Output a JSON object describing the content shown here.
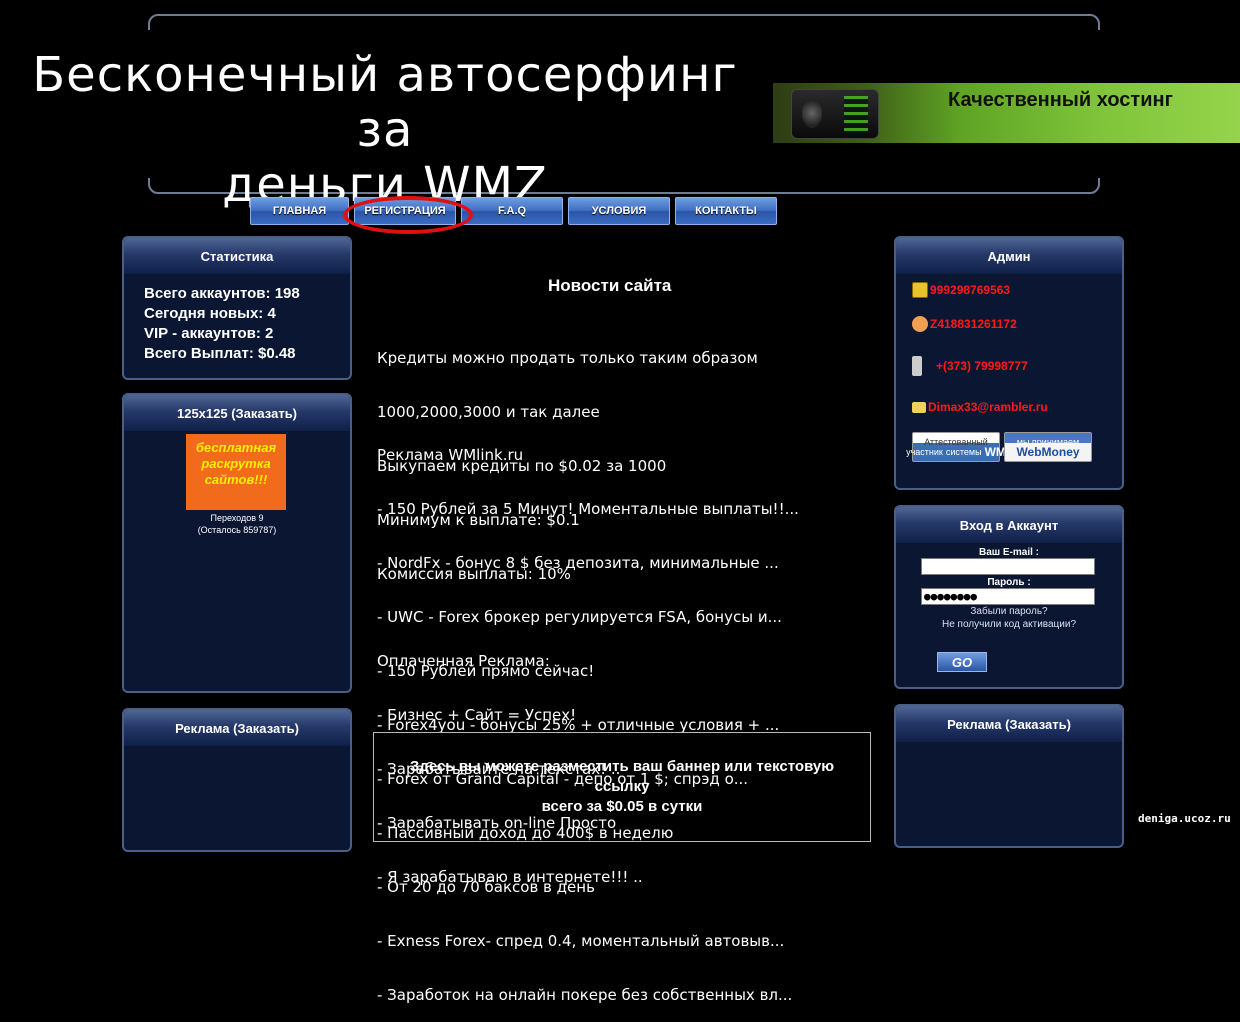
{
  "site": {
    "title_line1": "Бесконечный автосерфинг за",
    "title_line2": "деньги WMZ",
    "domain": "deniga.ucoz.ru"
  },
  "hosting_banner": {
    "text": "Качественный хостинг"
  },
  "nav": [
    "ГЛАВНАЯ",
    "РЕГИСТРАЦИЯ",
    "F.A.Q",
    "УСЛОВИЯ",
    "КОНТАКТЫ"
  ],
  "stats": {
    "title": "Статистика",
    "lines": [
      "Всего аккаунтов: 198",
      "Сегодня новых: 4",
      "VIP - аккаунтов: 2",
      "Всего Выплат: $0.48"
    ]
  },
  "ad125": {
    "title": "125x125 (Заказать)",
    "banner_text": "бесплатная раскрутка сайтов!!!",
    "clicks": "Переходов 9",
    "remaining": "(Осталось 859787)"
  },
  "left_ads": {
    "title": "Реклама (Заказать)"
  },
  "admin": {
    "title": "Админ",
    "icq": "999298769563",
    "wmid": "Z418831261172",
    "phone": "+(373) 79998777",
    "email": "Dimax33@rambler.ru",
    "wm_attest": [
      "Аттестованный",
      "участник",
      "системы",
      "WM"
    ],
    "wm_accept": [
      "мы принимаем",
      "WebMoney"
    ]
  },
  "login": {
    "title": "Вход в Аккаунт",
    "email_label": "Ваш E-mail :",
    "email_value": "",
    "password_label": "Пароль :",
    "password_value": "●●●●●●●●",
    "forgot": "Забыли пароль?",
    "no_code": "Не получили код активации?",
    "go": "GO"
  },
  "right_ads": {
    "title": "Реклама (Заказать)"
  },
  "news": {
    "title": "Новости сайта",
    "block1": [
      "Кредиты можно продать только таким образом",
      "1000,2000,3000 и так далее",
      "Выкупаем кредиты по $0.02 за 1000",
      "Минимум к выплате: $0.1",
      "Комиссия выплаты: 10%"
    ],
    "block2": [
      "Реклама WMlink.ru",
      "- 150 Рублей за 5 Минут! Моментальные выплаты!!...",
      "- NordFx - бонус 8 $ без депозита, минимальные ...",
      "- UWC - Forex брокер регулируется FSA, бонусы и...",
      "- 150 Рублей прямо сейчас!",
      "- Forex4you - бонусы 25% + отличные условия + ...",
      "- Forex от Grand Capital - депо от 1 $; спрэд о...",
      "- Пассивный доход до 400$ в неделю",
      "- От 20 до 70 баксов в день",
      "- Exness Forex- спред 0.4, моментальный автовыв...",
      "- Заработок на онлайн покере без собственных вл..."
    ],
    "block3": [
      "Оплаченная Реклама:",
      "- Бизнес + Сайт = Успех!",
      "- Зарабатывайте на текстах! ..",
      "- Зарабатывать on-line Просто",
      "- Я зарабатываю в интернете!!! .."
    ]
  },
  "banner_offer": {
    "line1": "Здесь вы можете разместить ваш баннер или текстовую",
    "line2": "ссылку",
    "line3": "всего за $0.05 в сутки"
  }
}
